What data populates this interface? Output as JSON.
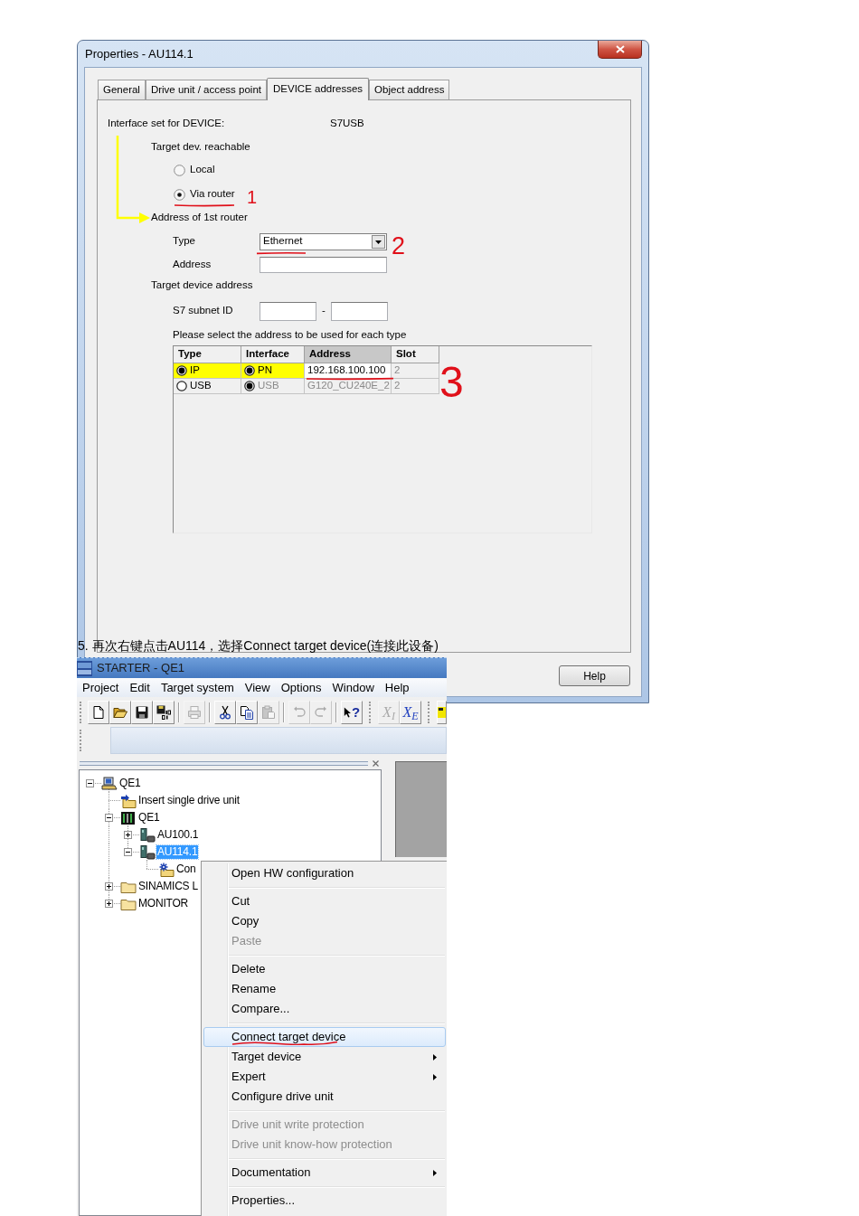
{
  "dialog": {
    "title": "Properties - AU114.1",
    "tabs": [
      {
        "label": "General",
        "selected": false
      },
      {
        "label": "Drive unit / access point",
        "selected": false
      },
      {
        "label": "DEVICE addresses",
        "selected": true
      },
      {
        "label": "Object address",
        "selected": false
      }
    ],
    "interface": {
      "label": "Interface set for DEVICE:",
      "value": "S7USB"
    },
    "reachable": {
      "label": "Target dev. reachable",
      "options": [
        {
          "label": "Local",
          "selected": false
        },
        {
          "label": "Via router",
          "selected": true
        }
      ]
    },
    "router": {
      "label": "Address of 1st router",
      "type_label": "Type",
      "type_value": "Ethernet",
      "address_label": "Address"
    },
    "target": {
      "label": "Target device address",
      "subnet_label": "S7 subnet ID",
      "separator": "-"
    },
    "table": {
      "caption": "Please select the address to be used for each type",
      "columns": [
        {
          "label": "Type",
          "selected": false
        },
        {
          "label": "Interface",
          "selected": false
        },
        {
          "label": "Address",
          "selected": true
        },
        {
          "label": "Slot",
          "selected": false
        }
      ],
      "rows": [
        {
          "highlighted": true,
          "cells": [
            {
              "kind": "radio",
              "text": "IP",
              "selected": true,
              "disabled": false
            },
            {
              "kind": "radio",
              "text": "PN",
              "selected": true,
              "disabled": false
            },
            {
              "kind": "text",
              "text": "192.168.100.100",
              "disabled": false
            },
            {
              "kind": "text",
              "text": "2",
              "disabled": true
            }
          ]
        },
        {
          "highlighted": false,
          "cells": [
            {
              "kind": "radio",
              "text": "USB",
              "selected": false,
              "disabled": false
            },
            {
              "kind": "radio",
              "text": "USB",
              "selected": true,
              "disabled": true
            },
            {
              "kind": "text",
              "text": "G120_CU240E_2",
              "disabled": true
            },
            {
              "kind": "text",
              "text": "2",
              "disabled": true
            }
          ]
        }
      ]
    },
    "buttons": [
      "Help"
    ]
  },
  "annotations": [
    {
      "text": "1"
    },
    {
      "text": "2"
    },
    {
      "text": "3"
    }
  ],
  "caption": "5. 再次右键点击AU114，选择Connect target device(连接此设备)",
  "starter": {
    "title": "STARTER - QE1",
    "menu": [
      "Project",
      "Edit",
      "Target system",
      "View",
      "Options",
      "Window",
      "Help"
    ],
    "toolbar": [
      [
        {
          "disabled": false
        },
        {
          "disabled": false
        },
        {
          "disabled": false
        },
        {
          "disabled": false
        }
      ],
      [
        {
          "disabled": true
        }
      ],
      [
        {
          "disabled": false
        },
        {
          "disabled": false
        },
        {
          "disabled": true
        }
      ],
      [
        {
          "disabled": true
        },
        {
          "disabled": true
        }
      ],
      [
        {
          "text": "?",
          "disabled": false
        }
      ],
      [
        {
          "text": "X$_{I}$",
          "disabled": true
        },
        {
          "text": "X$_{E}$",
          "disabled": false
        }
      ],
      [
        {
          "disabled": false
        }
      ]
    ],
    "tree": [
      {
        "label": "QE1",
        "kind": "project",
        "expanded": true,
        "selected": false,
        "children": [
          {
            "label": "Insert single drive unit",
            "kind": "action",
            "selected": false
          },
          {
            "label": "QE1",
            "kind": "device",
            "expanded": true,
            "selected": false,
            "children": [
              {
                "label": "AU100.1",
                "kind": "drive",
                "expanded": false,
                "selected": false
              },
              {
                "label": "AU114.1",
                "kind": "drive",
                "expanded": true,
                "selected": true,
                "children": [
                  {
                    "label": "Con",
                    "kind": "configuration",
                    "selected": false
                  }
                ]
              }
            ]
          },
          {
            "label": "SINAMICS L",
            "kind": "folder",
            "expanded": false,
            "selected": false
          },
          {
            "label": "MONITOR",
            "kind": "folder",
            "expanded": false,
            "selected": false
          }
        ]
      }
    ],
    "context_menu": [
      {
        "kind": "item",
        "label": "Open HW configuration",
        "selected": false,
        "disabled": false,
        "submenu": false
      },
      {
        "kind": "separator"
      },
      {
        "kind": "item",
        "label": "Cut",
        "selected": false,
        "disabled": false,
        "submenu": false
      },
      {
        "kind": "item",
        "label": "Copy",
        "selected": false,
        "disabled": false,
        "submenu": false
      },
      {
        "kind": "item",
        "label": "Paste",
        "selected": false,
        "disabled": true,
        "submenu": false
      },
      {
        "kind": "separator"
      },
      {
        "kind": "item",
        "label": "Delete",
        "selected": false,
        "disabled": false,
        "submenu": false
      },
      {
        "kind": "item",
        "label": "Rename",
        "selected": false,
        "disabled": false,
        "submenu": false
      },
      {
        "kind": "item",
        "label": "Compare...",
        "selected": false,
        "disabled": false,
        "submenu": false
      },
      {
        "kind": "separator"
      },
      {
        "kind": "item",
        "label": "Connect target device",
        "selected": true,
        "disabled": false,
        "submenu": false
      },
      {
        "kind": "item",
        "label": "Target device",
        "selected": false,
        "disabled": false,
        "submenu": true
      },
      {
        "kind": "item",
        "label": "Expert",
        "selected": false,
        "disabled": false,
        "submenu": true
      },
      {
        "kind": "item",
        "label": "Configure drive unit",
        "selected": false,
        "disabled": false,
        "submenu": false
      },
      {
        "kind": "separator"
      },
      {
        "kind": "item",
        "label": "Drive unit write protection",
        "selected": false,
        "disabled": true,
        "submenu": false
      },
      {
        "kind": "item",
        "label": "Drive unit know-how protection",
        "selected": false,
        "disabled": true,
        "submenu": false
      },
      {
        "kind": "separator"
      },
      {
        "kind": "item",
        "label": "Documentation",
        "selected": false,
        "disabled": false,
        "submenu": true
      },
      {
        "kind": "separator"
      },
      {
        "kind": "item",
        "label": "Properties...",
        "selected": false,
        "disabled": false,
        "submenu": false
      }
    ]
  }
}
